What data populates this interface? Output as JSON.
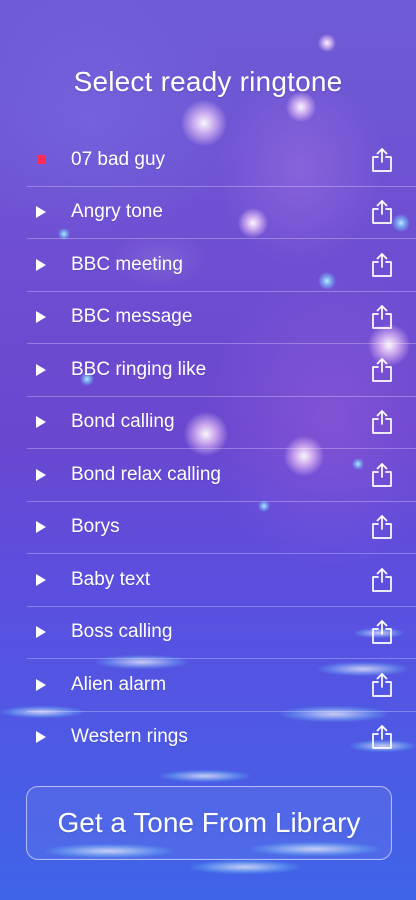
{
  "title": "Select ready ringtone",
  "ringtones": [
    {
      "name": "07 bad guy",
      "state": "playing"
    },
    {
      "name": "Angry tone",
      "state": "paused"
    },
    {
      "name": "BBC meeting",
      "state": "paused"
    },
    {
      "name": "BBC message",
      "state": "paused"
    },
    {
      "name": "BBC ringing like",
      "state": "paused"
    },
    {
      "name": "Bond calling",
      "state": "paused"
    },
    {
      "name": "Bond relax calling",
      "state": "paused"
    },
    {
      "name": "Borys",
      "state": "paused"
    },
    {
      "name": "Baby text",
      "state": "paused"
    },
    {
      "name": "Boss calling",
      "state": "paused"
    },
    {
      "name": "Alien alarm",
      "state": "paused"
    },
    {
      "name": "Western rings",
      "state": "paused"
    }
  ],
  "cta": {
    "label": "Get a Tone From Library"
  },
  "icons": {
    "play": "play-icon",
    "stop": "stop-icon",
    "share": "share-icon"
  },
  "colors": {
    "playing_indicator": "#ff2d55",
    "text": "#ffffff"
  }
}
